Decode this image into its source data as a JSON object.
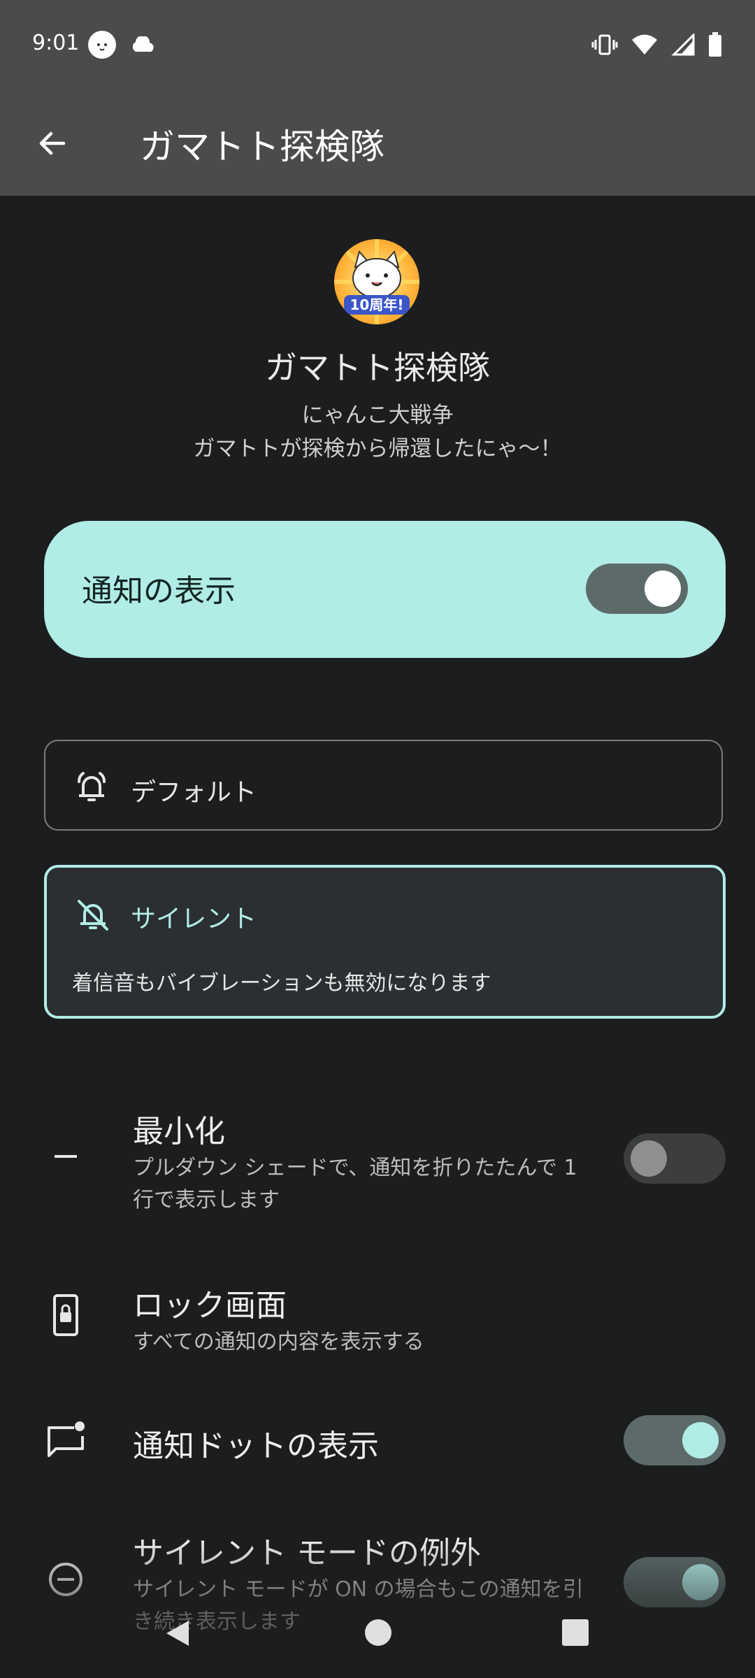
{
  "status": {
    "time": "9:01",
    "icons": [
      "cat-app-notification-icon",
      "cloud-icon",
      "vibrate-icon",
      "wifi-icon",
      "signal-icon",
      "battery-icon"
    ]
  },
  "appbar": {
    "title": "ガマトト探検隊"
  },
  "header": {
    "icon_badge": "10周年!",
    "title": "ガマトト探検隊",
    "app_name": "にゃんこ大戦争",
    "message": "ガマトトが探検から帰還したにゃ〜！"
  },
  "show_notifications": {
    "label": "通知の表示",
    "enabled": true
  },
  "options": {
    "default": {
      "label": "デフォルト",
      "selected": false
    },
    "silent": {
      "label": "サイレント",
      "description": "着信音もバイブレーションも無効になります",
      "selected": true
    }
  },
  "settings": {
    "minimize": {
      "title": "最小化",
      "description": "プルダウン シェードで、通知を折りたたんで 1 行で表示します",
      "enabled": false
    },
    "lock_screen": {
      "title": "ロック画面",
      "description": "すべての通知の内容を表示する"
    },
    "notification_dot": {
      "title": "通知ドットの表示",
      "enabled": true
    },
    "dnd_exception": {
      "title": "サイレント モードの例外",
      "description": "サイレント モードが ON の場合もこの通知を引き続き表示します",
      "enabled": true
    }
  },
  "colors": {
    "accent": "#b1ece6",
    "background": "#1c1d1e",
    "appbar": "#4a4b4b"
  }
}
